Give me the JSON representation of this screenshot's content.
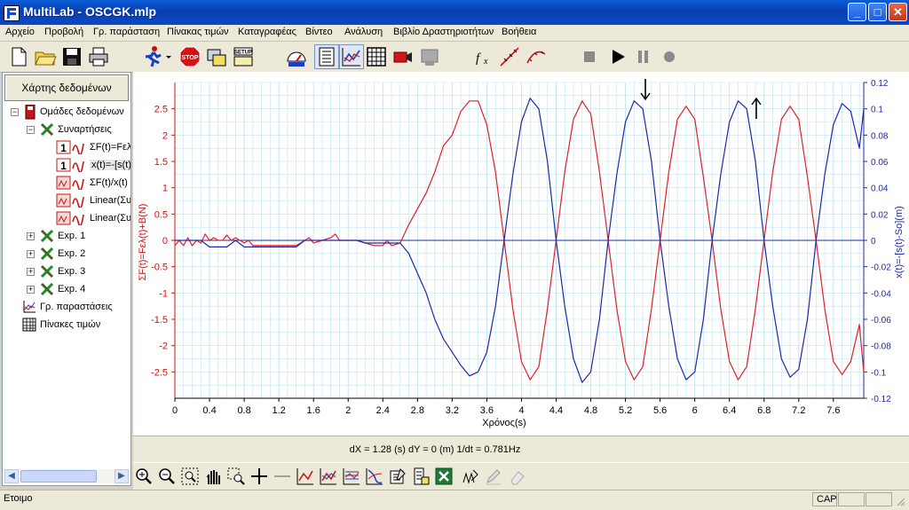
{
  "window": {
    "title": "MultiLab - OSCGK.mlp"
  },
  "menu": [
    {
      "label": "Αρχείο"
    },
    {
      "label": "Προβολή"
    },
    {
      "label": "Γρ. παράσταση"
    },
    {
      "label": "Πίνακας τιμών"
    },
    {
      "label": "Καταγραφέας"
    },
    {
      "label": "Βίντεο"
    },
    {
      "label": "Ανάλυση"
    },
    {
      "label": "Βιβλίο Δραστηριοτήτων"
    },
    {
      "label": "Βοήθεια"
    }
  ],
  "sidebar": {
    "header": "Χάρτης δεδομένων",
    "root": "Ομάδες δεδομένων",
    "functions_group": "Συναρτήσεις",
    "functions": [
      "ΣF(t)=Fελ",
      "x(t)=-[s(t)-S",
      "ΣF(t)/x(t)",
      "Linear(Συ",
      "Linear(Συ"
    ],
    "experiments": [
      "Exp. 1",
      "Exp. 2",
      "Exp. 3",
      "Exp. 4"
    ],
    "graphs": "Γρ. παραστάσεις",
    "tables": "Πίνακες τιμών"
  },
  "chart_data": {
    "type": "line",
    "xlabel": "Χρόνος(s)",
    "ylabel_left": "ΣF(t)=Fελ(t)+B(N)",
    "ylabel_right": "x(t)=-[s(t)-So](m)",
    "xlim": [
      0,
      7.95
    ],
    "ylim_left": [
      -3,
      3
    ],
    "ylim_right": [
      -0.12,
      0.12
    ],
    "xticks": [
      "0",
      "0.4",
      "0.8",
      "1.2",
      "1.6",
      "2",
      "2.4",
      "2.8",
      "3.2",
      "3.6",
      "4",
      "4.4",
      "4.8",
      "5.2",
      "5.6",
      "6",
      "6.4",
      "6.8",
      "7.2",
      "7.6"
    ],
    "yticks_left": [
      "2.5",
      "2",
      "1.5",
      "1",
      "0.5",
      "0",
      "-0.5",
      "-1",
      "-1.5",
      "-2",
      "-2.5"
    ],
    "yticks_right": [
      "0.12",
      "0.1",
      "0.08",
      "0.06",
      "0.04",
      "0.02",
      "0",
      "-0.02",
      "-0.04",
      "-0.06",
      "-0.08",
      "-0.1",
      "-0.12"
    ],
    "grid": true,
    "series": [
      {
        "axis": "left",
        "color": "#e0202a",
        "points": [
          [
            0,
            -0.1
          ],
          [
            0.05,
            0
          ],
          [
            0.1,
            -0.1
          ],
          [
            0.15,
            0.05
          ],
          [
            0.2,
            -0.1
          ],
          [
            0.25,
            0
          ],
          [
            0.3,
            -0.05
          ],
          [
            0.35,
            0.12
          ],
          [
            0.4,
            0
          ],
          [
            0.45,
            0.05
          ],
          [
            0.5,
            0
          ],
          [
            0.55,
            0
          ],
          [
            0.6,
            0.1
          ],
          [
            0.65,
            0
          ],
          [
            0.7,
            0.05
          ],
          [
            0.75,
            0
          ],
          [
            0.8,
            -0.05
          ],
          [
            0.85,
            0
          ],
          [
            0.9,
            -0.1
          ],
          [
            1.0,
            -0.1
          ],
          [
            1.2,
            -0.1
          ],
          [
            1.4,
            -0.1
          ],
          [
            1.5,
            0
          ],
          [
            1.55,
            0.05
          ],
          [
            1.6,
            -0.05
          ],
          [
            1.7,
            0
          ],
          [
            1.8,
            0.05
          ],
          [
            1.85,
            0.12
          ],
          [
            1.9,
            0
          ],
          [
            2.0,
            0
          ],
          [
            2.1,
            0
          ],
          [
            2.2,
            -0.05
          ],
          [
            2.3,
            -0.1
          ],
          [
            2.4,
            -0.1
          ],
          [
            2.45,
            0
          ],
          [
            2.5,
            -0.1
          ],
          [
            2.6,
            -0.05
          ],
          [
            2.7,
            0.3
          ],
          [
            2.8,
            0.6
          ],
          [
            2.9,
            0.9
          ],
          [
            3.0,
            1.3
          ],
          [
            3.1,
            1.8
          ],
          [
            3.2,
            2.0
          ],
          [
            3.3,
            2.45
          ],
          [
            3.4,
            2.65
          ],
          [
            3.5,
            2.65
          ],
          [
            3.6,
            2.2
          ],
          [
            3.7,
            1.3
          ],
          [
            3.8,
            0
          ],
          [
            3.9,
            -1.3
          ],
          [
            4.0,
            -2.3
          ],
          [
            4.1,
            -2.65
          ],
          [
            4.2,
            -2.4
          ],
          [
            4.3,
            -1.3
          ],
          [
            4.4,
            0
          ],
          [
            4.5,
            1.3
          ],
          [
            4.6,
            2.3
          ],
          [
            4.7,
            2.65
          ],
          [
            4.8,
            2.4
          ],
          [
            4.9,
            1.3
          ],
          [
            5.0,
            0
          ],
          [
            5.1,
            -1.3
          ],
          [
            5.2,
            -2.3
          ],
          [
            5.3,
            -2.65
          ],
          [
            5.4,
            -2.4
          ],
          [
            5.5,
            -1.3
          ],
          [
            5.6,
            0
          ],
          [
            5.7,
            1.3
          ],
          [
            5.8,
            2.3
          ],
          [
            5.9,
            2.55
          ],
          [
            6.0,
            2.3
          ],
          [
            6.1,
            1.2
          ],
          [
            6.2,
            0
          ],
          [
            6.3,
            -1.3
          ],
          [
            6.4,
            -2.3
          ],
          [
            6.5,
            -2.65
          ],
          [
            6.6,
            -2.4
          ],
          [
            6.7,
            -1.3
          ],
          [
            6.8,
            0
          ],
          [
            6.9,
            1.3
          ],
          [
            7.0,
            2.3
          ],
          [
            7.1,
            2.55
          ],
          [
            7.2,
            2.3
          ],
          [
            7.3,
            1.2
          ],
          [
            7.4,
            0
          ],
          [
            7.5,
            -1.3
          ],
          [
            7.6,
            -2.3
          ],
          [
            7.7,
            -2.55
          ],
          [
            7.8,
            -2.3
          ],
          [
            7.9,
            -1.6
          ],
          [
            7.95,
            -2.5
          ]
        ]
      },
      {
        "axis": "right",
        "color": "#1c2aa8",
        "points": [
          [
            0,
            0
          ],
          [
            0.1,
            0
          ],
          [
            0.2,
            0
          ],
          [
            0.3,
            0
          ],
          [
            0.4,
            -0.005
          ],
          [
            0.5,
            -0.005
          ],
          [
            0.6,
            -0.005
          ],
          [
            0.7,
            0
          ],
          [
            0.8,
            -0.005
          ],
          [
            0.9,
            -0.005
          ],
          [
            1.0,
            -0.005
          ],
          [
            1.2,
            -0.005
          ],
          [
            1.4,
            -0.005
          ],
          [
            1.5,
            0
          ],
          [
            1.6,
            0
          ],
          [
            1.7,
            0
          ],
          [
            1.8,
            0
          ],
          [
            1.9,
            0
          ],
          [
            2.0,
            0
          ],
          [
            2.1,
            0
          ],
          [
            2.2,
            -0.002
          ],
          [
            2.4,
            -0.002
          ],
          [
            2.6,
            -0.002
          ],
          [
            2.7,
            -0.01
          ],
          [
            2.8,
            -0.025
          ],
          [
            2.9,
            -0.04
          ],
          [
            3.0,
            -0.06
          ],
          [
            3.1,
            -0.075
          ],
          [
            3.2,
            -0.085
          ],
          [
            3.3,
            -0.095
          ],
          [
            3.4,
            -0.103
          ],
          [
            3.5,
            -0.1
          ],
          [
            3.6,
            -0.085
          ],
          [
            3.7,
            -0.05
          ],
          [
            3.8,
            0
          ],
          [
            3.9,
            0.05
          ],
          [
            4.0,
            0.09
          ],
          [
            4.1,
            0.108
          ],
          [
            4.2,
            0.1
          ],
          [
            4.3,
            0.06
          ],
          [
            4.4,
            0
          ],
          [
            4.5,
            -0.05
          ],
          [
            4.6,
            -0.09
          ],
          [
            4.7,
            -0.108
          ],
          [
            4.8,
            -0.1
          ],
          [
            4.9,
            -0.06
          ],
          [
            5.0,
            0
          ],
          [
            5.1,
            0.05
          ],
          [
            5.2,
            0.09
          ],
          [
            5.3,
            0.106
          ],
          [
            5.4,
            0.1
          ],
          [
            5.5,
            0.06
          ],
          [
            5.6,
            0
          ],
          [
            5.7,
            -0.05
          ],
          [
            5.8,
            -0.09
          ],
          [
            5.9,
            -0.106
          ],
          [
            6.0,
            -0.1
          ],
          [
            6.1,
            -0.06
          ],
          [
            6.2,
            0
          ],
          [
            6.3,
            0.05
          ],
          [
            6.4,
            0.09
          ],
          [
            6.5,
            0.106
          ],
          [
            6.6,
            0.1
          ],
          [
            6.7,
            0.06
          ],
          [
            6.8,
            0
          ],
          [
            6.9,
            -0.05
          ],
          [
            7.0,
            -0.09
          ],
          [
            7.1,
            -0.104
          ],
          [
            7.2,
            -0.098
          ],
          [
            7.3,
            -0.06
          ],
          [
            7.4,
            0
          ],
          [
            7.5,
            0.05
          ],
          [
            7.6,
            0.088
          ],
          [
            7.7,
            0.104
          ],
          [
            7.8,
            0.098
          ],
          [
            7.9,
            0.07
          ],
          [
            7.95,
            0.1
          ]
        ]
      }
    ],
    "cursors": [
      {
        "x": 5.43,
        "direction": "down"
      },
      {
        "x": 6.71,
        "direction": "up"
      }
    ]
  },
  "readout": "dX = 1.28 (s) dY = 0 (m)  1/dt = 0.781Hz",
  "status": {
    "text": "Ετοιμο",
    "cap": "CAP"
  },
  "colors": {
    "red_series": "#e0202a",
    "blue_series": "#1c2aa8",
    "grid": "#bfe3f2",
    "title_bar": "#0a49c4"
  }
}
